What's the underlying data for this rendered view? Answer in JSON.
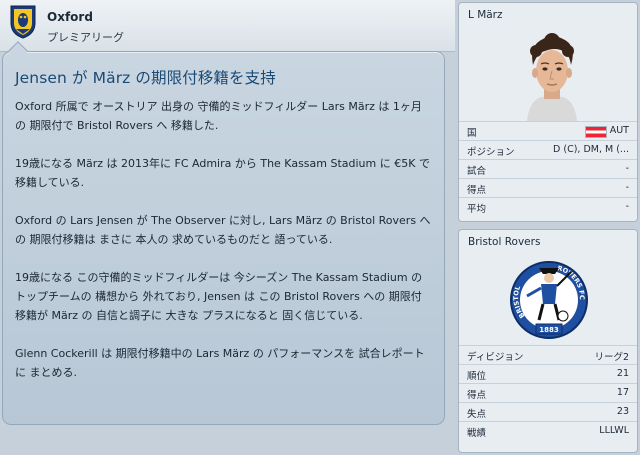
{
  "header": {
    "club": "Oxford",
    "league": "プレミアリーグ"
  },
  "news": {
    "title": "Jensen が März の期限付移籍を支持",
    "paragraphs": [
      "Oxford 所属で オーストリア 出身の 守備的ミッドフィルダー Lars März は 1ヶ月の 期限付で Bristol Rovers へ 移籍した.",
      "19歳になる März は 2013年に FC Admira から The Kassam Stadium に €5K で 移籍している.",
      "Oxford の Lars Jensen が The Observer に対し, Lars März の Bristol Rovers への 期限付移籍は まさに 本人の 求めているものだと 語っている.",
      "19歳になる この守備的ミッドフィルダーは 今シーズン The Kassam Stadium の トップチームの 構想から 外れており, Jensen は この Bristol Rovers への 期限付移籍が März の 自信と調子に 大きな プラスになると 固く信じている.",
      "Glenn Cockerill は 期限付移籍中の Lars März の パフォーマンスを 試合レポートに まとめる."
    ]
  },
  "player": {
    "name": "L März",
    "rows": [
      {
        "label": "国",
        "value": "AUT"
      },
      {
        "label": "ポジション",
        "value": "D (C), DM, M (..."
      },
      {
        "label": "試合",
        "value": "-"
      },
      {
        "label": "得点",
        "value": "-"
      },
      {
        "label": "平均",
        "value": "-"
      }
    ]
  },
  "club": {
    "name": "Bristol Rovers",
    "logo_text": {
      "left": "BRISTOL",
      "right": "ROVERS FC",
      "year": "1883"
    },
    "rows": [
      {
        "label": "ディビジョン",
        "value": "リーグ2"
      },
      {
        "label": "順位",
        "value": "21"
      },
      {
        "label": "得点",
        "value": "17"
      },
      {
        "label": "失点",
        "value": "23"
      },
      {
        "label": "戦績",
        "value": "LLLWL"
      }
    ]
  },
  "colors": {
    "title_blue": "#1b4a74",
    "austria_red": "#ee2436",
    "rovers_blue": "#1f4fa0"
  },
  "icons": {
    "club_crest": "oxford-crest-icon",
    "flag": "austria-flag-icon",
    "logo": "bristol-rovers-logo"
  }
}
